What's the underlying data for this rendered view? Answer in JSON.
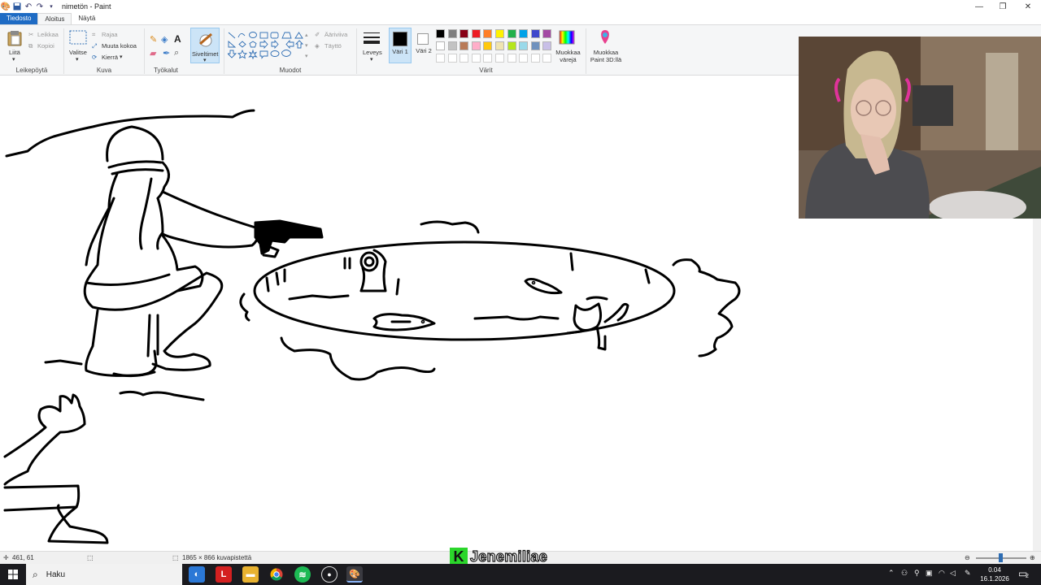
{
  "window": {
    "title": "nimetön - Paint",
    "controls": {
      "minimize": "—",
      "restore": "❐",
      "close": "✕"
    }
  },
  "tabs": [
    {
      "label": "Tiedosto"
    },
    {
      "label": "Aloitus"
    },
    {
      "label": "Näytä"
    }
  ],
  "ribbon": {
    "clipboard": {
      "label": "Leikepöytä",
      "paste": "Liitä",
      "cut": "Leikkaa",
      "copy": "Kopioi"
    },
    "image": {
      "label": "Kuva",
      "select": "Valitse",
      "crop": "Rajaa",
      "resize": "Muuta kokoa",
      "rotate": "Kierrä"
    },
    "tools": {
      "label": "Työkalut"
    },
    "brushes": {
      "label": "Siveltimet"
    },
    "shapes": {
      "label": "Muodot",
      "outline": "Ääriviiva",
      "fill": "Täyttö"
    },
    "size": {
      "label": "Leveys"
    },
    "color1": {
      "label": "Väri 1"
    },
    "color2": {
      "label": "Väri 2"
    },
    "colors": {
      "label": "Värit",
      "edit": "Muokkaa värejä",
      "paint3d": "Muokkaa Paint 3D:llä"
    },
    "palette": [
      "#000000",
      "#7f7f7f",
      "#880015",
      "#ed1c24",
      "#ff7f27",
      "#fff200",
      "#22b14c",
      "#00a2e8",
      "#3f48cc",
      "#a349a4",
      "#ffffff",
      "#c3c3c3",
      "#b97a57",
      "#ffaec9",
      "#ffc90e",
      "#efe4b0",
      "#b5e61d",
      "#99d9ea",
      "#7092be",
      "#c8bfe7",
      "#ffffff",
      "#ffffff",
      "#ffffff",
      "#ffffff",
      "#ffffff",
      "#ffffff",
      "#ffffff",
      "#ffffff",
      "#ffffff",
      "#ffffff"
    ],
    "color1_value": "#000000",
    "color2_value": "#ffffff"
  },
  "status": {
    "cursor_pos": "461, 61",
    "canvas_size": "1865 × 866 kuvapistettä"
  },
  "overlay": {
    "streamer_badge": "K",
    "streamer_name": "Jenemiliae"
  },
  "taskbar": {
    "search_placeholder": "Haku",
    "time": "0.04",
    "date": "16.1.2026",
    "notification_count": "2"
  }
}
